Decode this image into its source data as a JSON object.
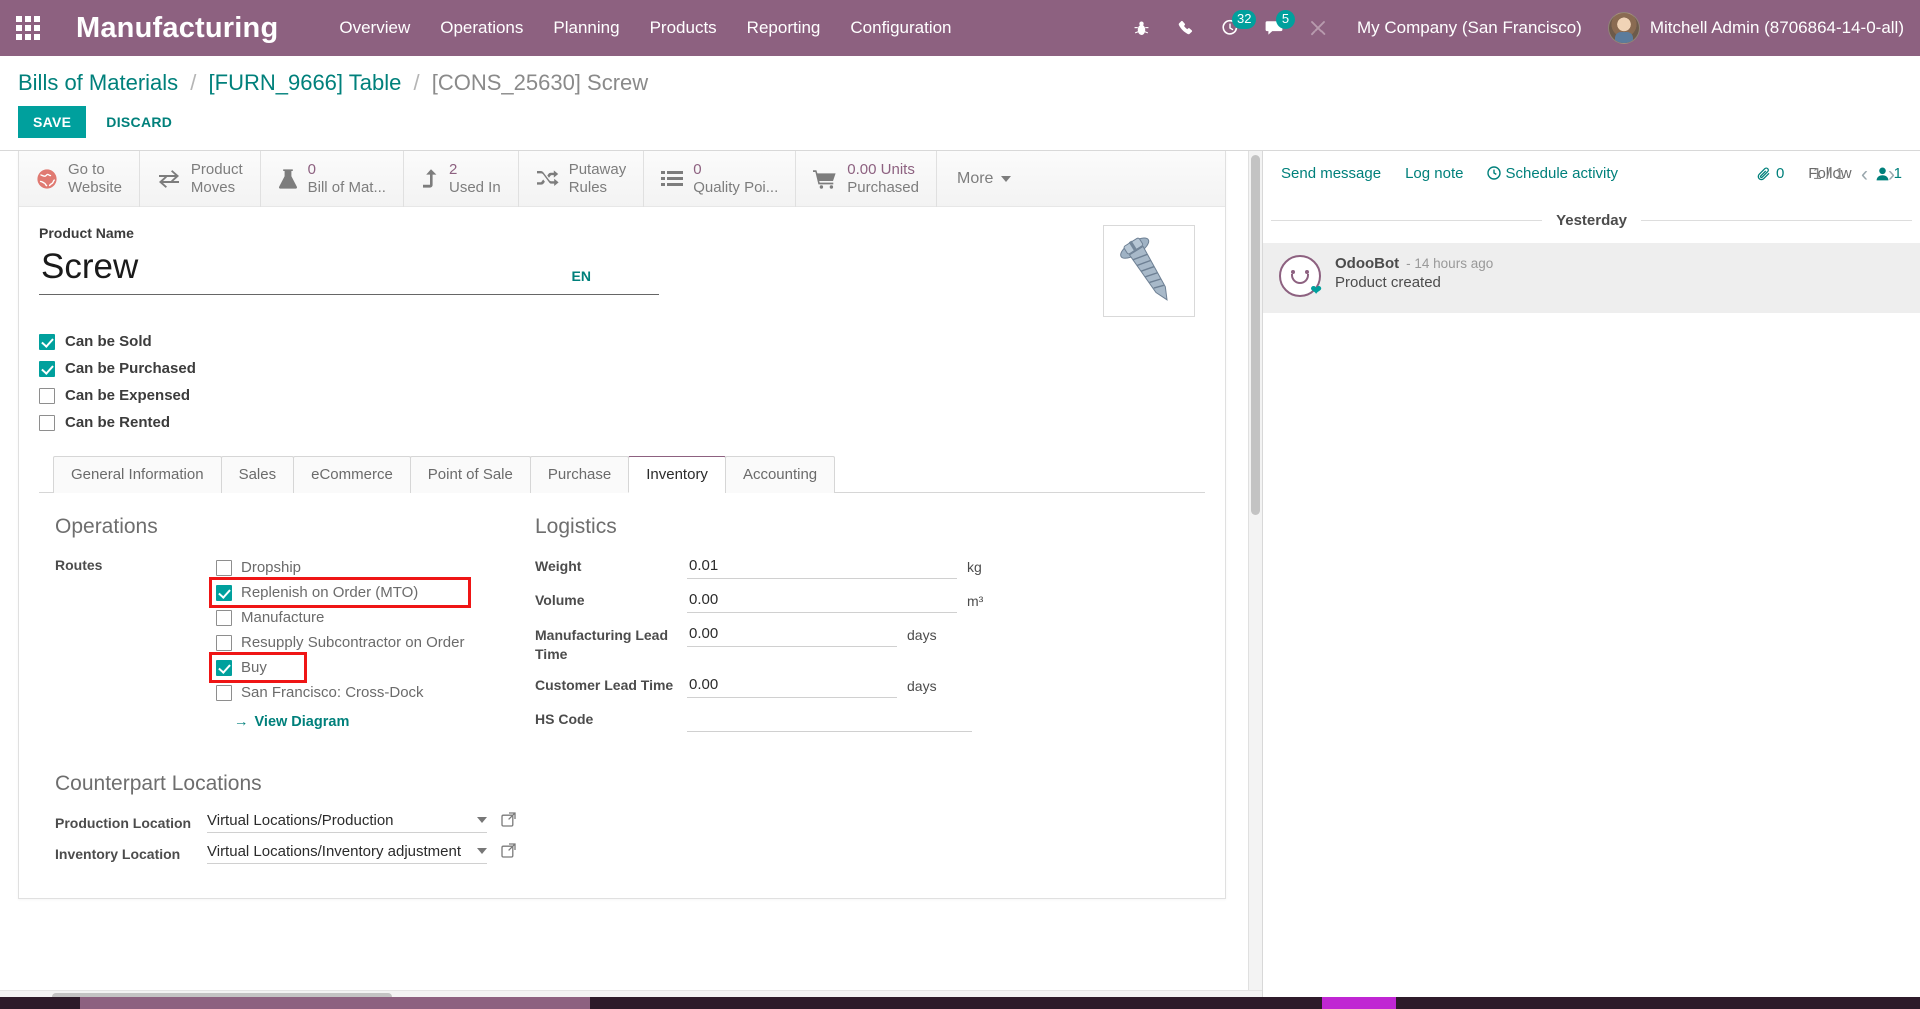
{
  "navbar": {
    "brand": "Manufacturing",
    "menu": [
      "Overview",
      "Operations",
      "Planning",
      "Products",
      "Reporting",
      "Configuration"
    ],
    "icons": [
      {
        "name": "bug-icon",
        "glyph": "☢"
      },
      {
        "name": "phone-icon",
        "glyph": "☎"
      },
      {
        "name": "activities-clock-icon",
        "glyph": "◔",
        "badge": "32"
      },
      {
        "name": "messages-icon",
        "glyph": "὞9",
        "badge": "5"
      },
      {
        "name": "tools-icon",
        "glyph": "⚒"
      }
    ],
    "activities_count": "32",
    "messages_count": "5",
    "company": "My Company (San Francisco)",
    "user": "Mitchell Admin (8706864-14-0-all)"
  },
  "control_panel": {
    "breadcrumb": [
      {
        "label": "Bills of Materials",
        "state": "link"
      },
      {
        "label": "[FURN_9666] Table",
        "state": "link"
      },
      {
        "label": "[CONS_25630] Screw",
        "state": "current"
      }
    ],
    "separator": "/",
    "save_label": "SAVE",
    "discard_label": "DISCARD",
    "pager_text": "1 / 1",
    "prev_glyph": "‹",
    "next_glyph": "›"
  },
  "stat_buttons": [
    {
      "name": "go-to-website",
      "icon": "globe-icon",
      "value": "",
      "label_line1": "Go to",
      "label_line2": "Website"
    },
    {
      "name": "product-moves",
      "icon": "exchange-icon",
      "value": "",
      "label_line1": "Product",
      "label_line2": "Moves"
    },
    {
      "name": "bill-of-materials",
      "icon": "flask-icon",
      "value": "0",
      "label_line1": "",
      "label_line2": "Bill of Mat..."
    },
    {
      "name": "used-in",
      "icon": "level-up-icon",
      "value": "2",
      "label_line1": "",
      "label_line2": "Used In"
    },
    {
      "name": "putaway-rules",
      "icon": "random-icon",
      "value": "",
      "label_line1": "Putaway",
      "label_line2": "Rules"
    },
    {
      "name": "quality-points",
      "icon": "list-icon",
      "value": "0",
      "label_line1": "",
      "label_line2": "Quality Poi..."
    },
    {
      "name": "purchased",
      "icon": "cart-icon",
      "value": "0.00 Units",
      "label_line1": "",
      "label_line2": "Purchased"
    }
  ],
  "more_button": "More",
  "product": {
    "name_label": "Product Name",
    "name_value": "Screw",
    "language_badge": "EN",
    "image_alt": "screw-photo",
    "flags": [
      {
        "label": "Can be Sold",
        "checked": true
      },
      {
        "label": "Can be Purchased",
        "checked": true
      },
      {
        "label": "Can be Expensed",
        "checked": false
      },
      {
        "label": "Can be Rented",
        "checked": false
      }
    ]
  },
  "tabs": [
    {
      "label": "General Information",
      "active": false
    },
    {
      "label": "Sales",
      "active": false
    },
    {
      "label": "eCommerce",
      "active": false
    },
    {
      "label": "Point of Sale",
      "active": false
    },
    {
      "label": "Purchase",
      "active": false
    },
    {
      "label": "Inventory",
      "active": true
    },
    {
      "label": "Accounting",
      "active": false
    }
  ],
  "inventory_tab": {
    "operations": {
      "title": "Operations",
      "routes_label": "Routes",
      "routes": [
        {
          "label": "Dropship",
          "checked": false,
          "highlighted": false
        },
        {
          "label": "Replenish on Order (MTO)",
          "checked": true,
          "highlighted": true
        },
        {
          "label": "Manufacture",
          "checked": false,
          "highlighted": false
        },
        {
          "label": "Resupply Subcontractor on Order",
          "checked": false,
          "highlighted": false
        },
        {
          "label": "Buy",
          "checked": true,
          "highlighted": true
        },
        {
          "label": "San Francisco: Cross-Dock",
          "checked": false,
          "highlighted": false
        }
      ],
      "view_diagram": "View Diagram",
      "view_diagram_arrow": "→"
    },
    "logistics": {
      "title": "Logistics",
      "fields": [
        {
          "label": "Weight",
          "value": "0.01",
          "unit": "kg"
        },
        {
          "label": "Volume",
          "value": "0.00",
          "unit": "m³"
        },
        {
          "label": "Manufacturing Lead Time",
          "value": "0.00",
          "unit": "days"
        },
        {
          "label": "Customer Lead Time",
          "value": "0.00",
          "unit": "days"
        },
        {
          "label": "HS Code",
          "value": "",
          "unit": ""
        }
      ]
    },
    "counterpart_locations": {
      "title": "Counterpart Locations",
      "fields": [
        {
          "label": "Production Location",
          "value": "Virtual Locations/Production"
        },
        {
          "label": "Inventory Location",
          "value": "Virtual Locations/Inventory adjustment"
        }
      ]
    }
  },
  "chatter": {
    "send_message": "Send message",
    "log_note": "Log note",
    "schedule_activity": "Schedule activity",
    "schedule_icon": "clock-icon",
    "attachment_count": "0",
    "follow_label": "Follow",
    "followers_count": "1",
    "day_separator": "Yesterday",
    "messages": [
      {
        "author": "OdooBot",
        "time": "- 14 hours ago",
        "body": "Product created"
      }
    ]
  },
  "colors": {
    "brand_purple": "#8d6180",
    "teal": "#00a09d",
    "teal_dark": "#00807b",
    "highlight_red": "#ef1515"
  }
}
